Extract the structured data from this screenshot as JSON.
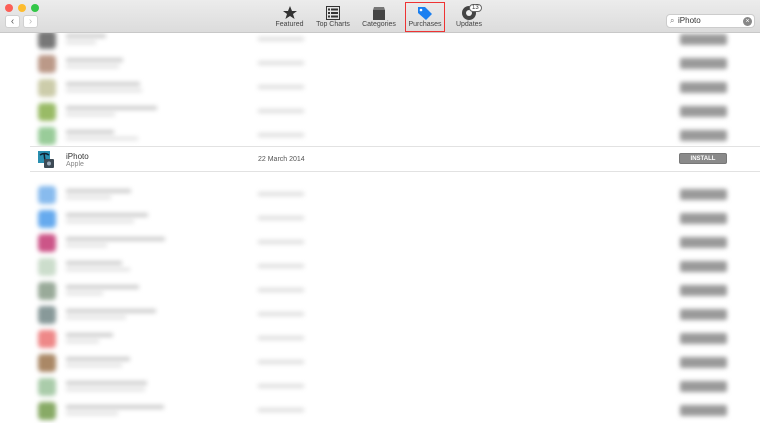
{
  "window": {
    "title": "App Store"
  },
  "toolbar": {
    "tabs": [
      {
        "label": "Featured",
        "icon": "star-icon"
      },
      {
        "label": "Top Charts",
        "icon": "list-icon"
      },
      {
        "label": "Categories",
        "icon": "box-icon"
      },
      {
        "label": "Purchases",
        "icon": "tag-icon",
        "active": true
      },
      {
        "label": "Updates",
        "icon": "updates-icon",
        "badge": "13"
      }
    ],
    "search": {
      "value": "iPhoto"
    }
  },
  "colors": {
    "accent": "#1a7ff0",
    "highlight": "#e33333"
  },
  "selected_item": {
    "name": "iPhoto",
    "developer": "Apple",
    "date": "22 March 2014",
    "button": "INSTALL"
  }
}
